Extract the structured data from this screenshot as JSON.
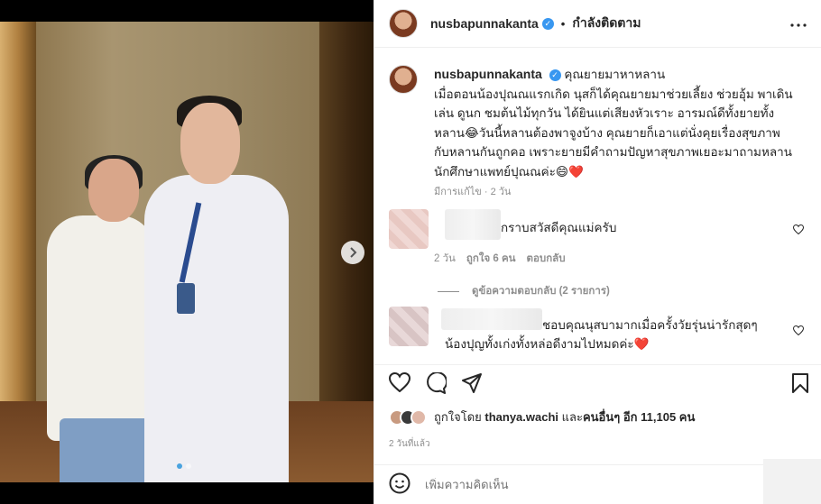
{
  "post": {
    "username": "nusbapunnakanta",
    "follow_label": "กำลังติดตาม",
    "follow_dot": "•",
    "caption_title": "คุณยายมาหาหลาน",
    "caption_text": "เมื่อตอนน้องปุณณแรกเกิด นุสก็ได้คุณยายมาช่วยเลี้ยง ช่วยอุ้ม พาเดิน เล่น ดูนก ชมต้นไม้ทุกวัน ได้ยินแต่เสียงหัวเราะ อารมณ์ดีทั้งยายทั้งหลาน😂วันนี้หลานต้องพาจูงบ้าง คุณยายก็เอาแต่นั่งคุยเรื่องสุขภาพกับหลานกันถูกคอ เพราะยายมีคำถามปัญหาสุขภาพเยอะมาถามหลานนักศึกษาแพทย์ปุณณค่ะ😄❤️",
    "edited_label": "มีการแก้ไข · 2 วัน"
  },
  "comments": [
    {
      "text": "กราบสวัสดีคุณแม่ครับ",
      "time": "2 วัน",
      "likes": "ถูกใจ 6 คน",
      "reply_label": "ตอบกลับ"
    },
    {
      "text": "ชอบคุณนุสบามากเมื่อครั้งวัยรุ่นน่ารักสุดๆ น้องปุญทั้งเก่งทั้งหล่อดีงามไปหมดค่ะ❤️"
    }
  ],
  "view_replies": "ดูข้อความตอบกลับ (2 รายการ)",
  "likes_line": {
    "prefix": "ถูกใจโดย",
    "user": "thanya.wachi",
    "middle": "และ",
    "others": "คนอื่นๆ อีก 11,105 คน"
  },
  "timestamp": "2 วันที่แล้ว",
  "add_comment_placeholder": "เพิ่มความคิดเห็น",
  "icons": {
    "more": "more-options-icon",
    "next": "chevron-right-icon",
    "like": "heart-icon",
    "comment": "comment-icon",
    "share": "share-icon",
    "save": "bookmark-icon",
    "emoji": "emoji-icon"
  },
  "colors": {
    "verified": "#3897f0",
    "link": "#262626",
    "meta": "#8e8e8e"
  }
}
